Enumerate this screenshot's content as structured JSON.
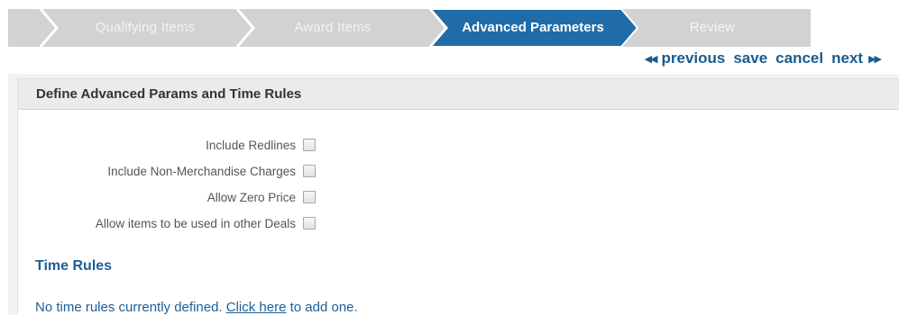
{
  "wizard": {
    "steps": [
      {
        "label": "Qualifying Items",
        "state": "inactive"
      },
      {
        "label": "Award Items",
        "state": "inactive"
      },
      {
        "label": "Advanced Parameters",
        "state": "active"
      },
      {
        "label": "Review",
        "state": "inactive"
      }
    ],
    "colors": {
      "active": "#1f6ca8",
      "inactive": "#cfcfcf",
      "divider": "#ffffff"
    }
  },
  "nav": {
    "previous_label": "previous",
    "save_label": "save",
    "cancel_label": "cancel",
    "next_label": "next",
    "previous_icon": "double-left-arrow-icon",
    "next_icon": "double-right-arrow-icon"
  },
  "panel": {
    "title": "Define Advanced Params and Time Rules",
    "params": [
      {
        "label": "Include Redlines",
        "checked": false
      },
      {
        "label": "Include Non-Merchandise Charges",
        "checked": false
      },
      {
        "label": "Allow Zero Price",
        "checked": false
      },
      {
        "label": "Allow items to be used in other Deals",
        "checked": false
      }
    ]
  },
  "time_rules": {
    "title": "Time Rules",
    "empty_before": "No time rules currently defined.",
    "link_text": "Click here",
    "empty_after": "to add one."
  }
}
